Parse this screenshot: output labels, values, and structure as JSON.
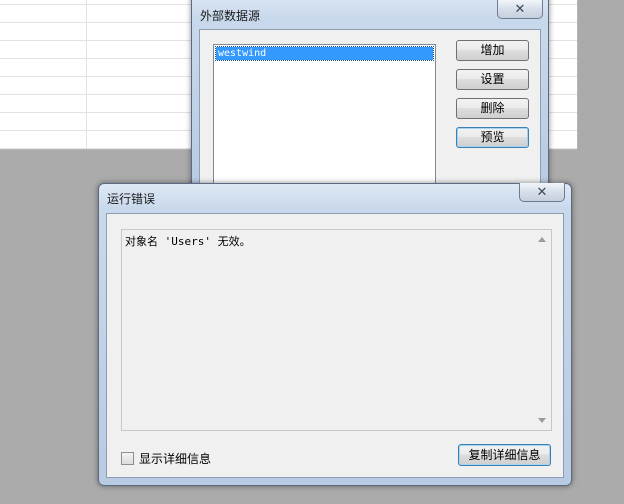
{
  "data_source_window": {
    "title": "外部数据源",
    "list_items": [
      "westwind"
    ],
    "buttons": {
      "add": "增加",
      "settings": "设置",
      "delete": "删除",
      "preview": "预览"
    }
  },
  "error_dialog": {
    "title": "运行错误",
    "message": "对象名 'Users' 无效。",
    "show_details_label": "显示详细信息",
    "copy_details_label": "复制详细信息"
  }
}
